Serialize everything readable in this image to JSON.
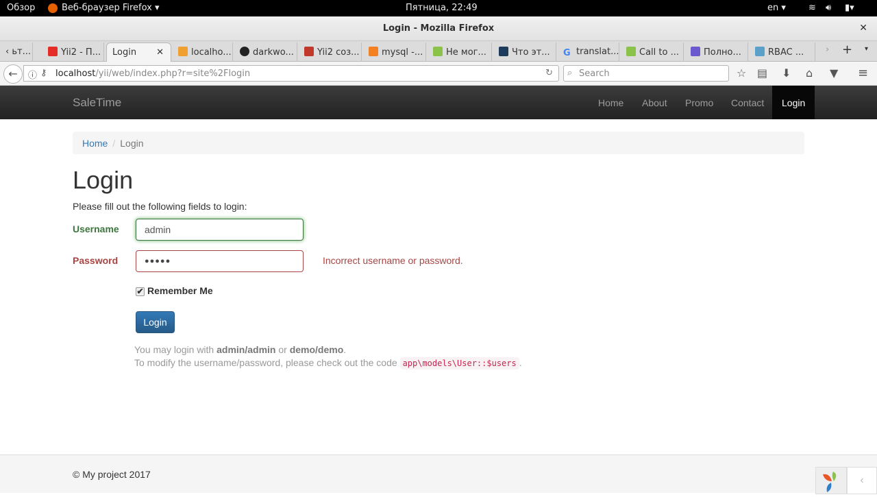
{
  "system_bar": {
    "activities": "Обзор",
    "app_menu": "Веб-браузер Firefox ▾",
    "clock": "Пятница, 22:49",
    "lang": "en ▾"
  },
  "window": {
    "title": "Login - Mozilla Firefox"
  },
  "tabs": [
    {
      "label": "ьт..."
    },
    {
      "label": "Yii2 - П..."
    },
    {
      "label": "Login"
    },
    {
      "label": "localho..."
    },
    {
      "label": "darkwo..."
    },
    {
      "label": "Yii2 соз..."
    },
    {
      "label": "mysql -..."
    },
    {
      "label": "Не мог..."
    },
    {
      "label": "Что эт..."
    },
    {
      "label": "translat..."
    },
    {
      "label": "Call to ..."
    },
    {
      "label": "Полно..."
    },
    {
      "label": "RBAC ..."
    }
  ],
  "urlbar": {
    "host": "localhost",
    "path": "/yii/web/index.php?r=site%2Flogin",
    "search_placeholder": "Search"
  },
  "site": {
    "brand": "SaleTime",
    "nav": [
      {
        "label": "Home"
      },
      {
        "label": "About"
      },
      {
        "label": "Promo"
      },
      {
        "label": "Contact"
      },
      {
        "label": "Login"
      }
    ],
    "breadcrumb": {
      "home": "Home",
      "current": "Login"
    },
    "title": "Login",
    "intro": "Please fill out the following fields to login:",
    "form": {
      "username_label": "Username",
      "username_value": "admin",
      "password_label": "Password",
      "password_value": "●●●●●",
      "password_error": "Incorrect username or password.",
      "remember_label": "Remember Me",
      "remember_checked": true,
      "submit_label": "Login"
    },
    "hint": {
      "p1": "You may login with ",
      "u1": "admin/admin",
      "or": " or ",
      "u2": "demo/demo",
      "end": ".",
      "p2": "To modify the username/password, please check out the code ",
      "code": "app\\models\\User::$users",
      "end2": "."
    },
    "footer": "© My project 2017"
  },
  "colors": {
    "success": "#3c763d",
    "error": "#a94442",
    "primary": "#337ab7"
  }
}
